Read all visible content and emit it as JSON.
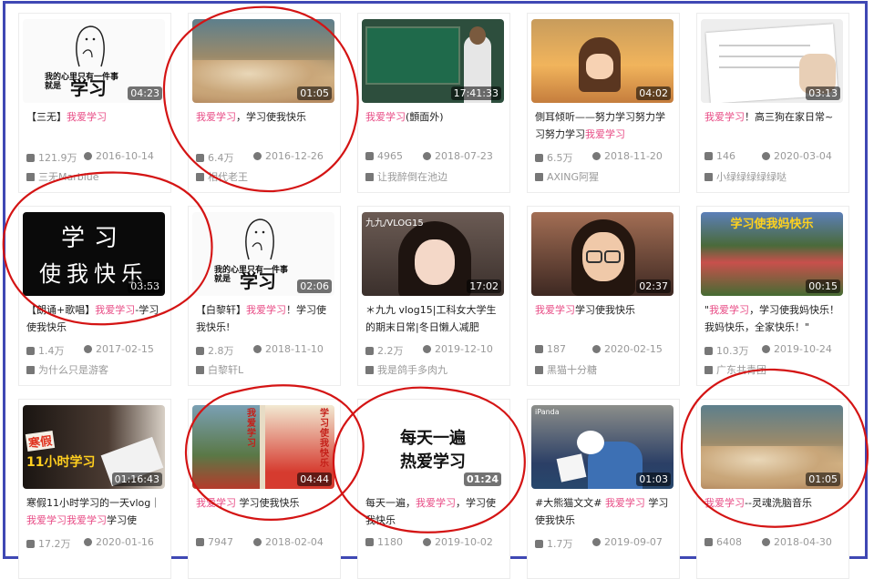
{
  "videos": [
    {
      "duration": "04:23",
      "title_pre": "【三无】",
      "title_hl": "我爱学习",
      "title_post": "",
      "views": "121.9万",
      "date": "2016-10-14",
      "uploader": "三无Marblue",
      "thumb": {
        "line1": "我的心里只有一件事",
        "line2": "就是",
        "big": "学习"
      }
    },
    {
      "duration": "01:05",
      "title_pre": "",
      "title_hl": "我爱学习",
      "title_post": "，学习使我快乐",
      "views": "6.4万",
      "date": "2016-12-26",
      "uploader": "相代老王"
    },
    {
      "duration": "17:41:33",
      "title_pre": "",
      "title_hl": "我爱学习",
      "title_post": "(顫面外)",
      "views": "4965",
      "date": "2018-07-23",
      "uploader": "让我醉倒在池边"
    },
    {
      "duration": "04:02",
      "title_pre": "側耳倾听——努力学习努力学习努力学习",
      "title_hl": "我爱学习",
      "title_post": "",
      "views": "6.5万",
      "date": "2018-11-20",
      "uploader": "AXING阿猩"
    },
    {
      "duration": "03:13",
      "title_pre": "",
      "title_hl": "我爱学习",
      "title_post": "！高三狗在家日常~",
      "views": "146",
      "date": "2020-03-04",
      "uploader": "小绿绿绿绿绿哒"
    },
    {
      "duration": "03:53",
      "title_pre": "【朗诵+歌唱】",
      "title_hl": "我爱学习",
      "title_post": "-学习使我快乐",
      "views": "1.4万",
      "date": "2017-02-15",
      "uploader": "为什么只是游客",
      "thumb": {
        "line1": "学习",
        "line2": "使我快乐"
      }
    },
    {
      "duration": "02:06",
      "title_pre": "【白黎轩】",
      "title_hl": "我爱学习",
      "title_post": "！学习使我快乐!",
      "views": "2.8万",
      "date": "2018-11-10",
      "uploader": "白黎轩L",
      "thumb": {
        "line1": "我的心里只有一件事",
        "line2": "就是",
        "big": "学习"
      }
    },
    {
      "duration": "17:02",
      "title_pre": "＊九九 vlog15|工科女大学生的期末日常|冬日懒人减肥",
      "title_hl": "",
      "title_post": "",
      "views": "2.2万",
      "date": "2019-12-10",
      "uploader": "我是鸽手多肉九",
      "thumb": {
        "tag": "九九/VLOG15"
      }
    },
    {
      "duration": "02:37",
      "title_pre": "",
      "title_hl": "我爱学习",
      "title_post": "学习使我快乐",
      "views": "187",
      "date": "2020-02-15",
      "uploader": "黑猫十分糖"
    },
    {
      "duration": "00:15",
      "title_pre": "\"",
      "title_hl": "我爱学习",
      "title_post": "，学习使我妈快乐！我妈快乐，全家快乐！\"",
      "views": "10.3万",
      "date": "2019-10-24",
      "uploader": "广东共青团",
      "thumb": {
        "tag": "学习使我妈快乐"
      }
    },
    {
      "duration": "01:16:43",
      "title_pre": "寒假11小时学习的一天vlog｜",
      "title_hl": "我爱学习我爱学习",
      "title_post": "学习使",
      "views": "17.2万",
      "date": "2020-01-16",
      "uploader": "",
      "thumb": {
        "r1": "寒假",
        "r2": "11小时学习"
      }
    },
    {
      "duration": "04:44",
      "title_pre": "",
      "title_hl": "我爱学习",
      "title_post": " 学习使我快乐",
      "views": "7947",
      "date": "2018-02-04",
      "uploader": "",
      "thumb": {
        "v1": "我爱学习",
        "v2": "学习使我快乐"
      }
    },
    {
      "duration": "01:24",
      "title_pre": "每天一遍，",
      "title_hl": "我爱学习",
      "title_post": "，学习使我快乐",
      "views": "1180",
      "date": "2019-10-02",
      "uploader": "",
      "thumb": {
        "line1": "每天一遍",
        "line2": "热爱学习"
      }
    },
    {
      "duration": "01:03",
      "title_pre": "#大熊猫文文# ",
      "title_hl": "我爱学习",
      "title_post": " 学习使我快乐",
      "views": "1.7万",
      "date": "2019-09-07",
      "uploader": "",
      "thumb": {
        "tag": "iPanda"
      }
    },
    {
      "duration": "01:05",
      "title_pre": "",
      "title_hl": "我爱学习",
      "title_post": "--灵魂洗脑音乐",
      "views": "6408",
      "date": "2018-04-30",
      "uploader": ""
    }
  ]
}
